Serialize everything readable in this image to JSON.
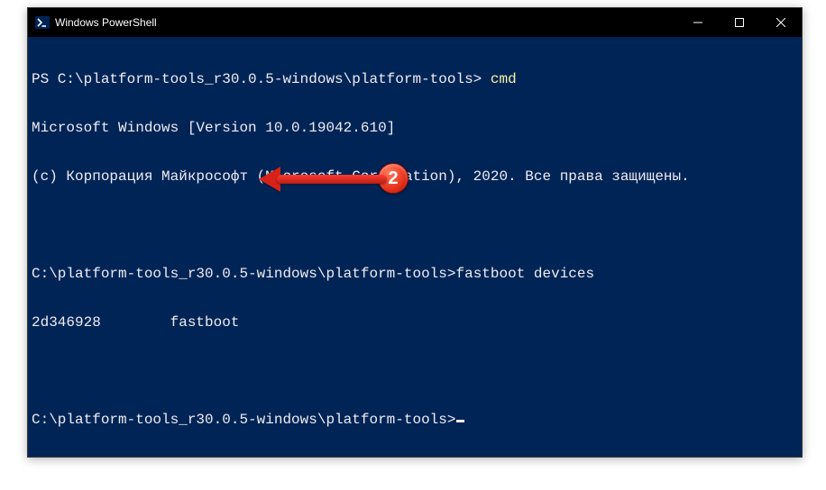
{
  "titlebar": {
    "title": "Windows PowerShell"
  },
  "terminal": {
    "l1_prompt": "PS C:\\platform-tools_r30.0.5-windows\\platform-tools> ",
    "l1_cmd": "cmd",
    "l2": "Microsoft Windows [Version 10.0.19042.610]",
    "l3": "(c) Корпорация Майкрософт (Microsoft Corporation), 2020. Все права защищены.",
    "l5_prompt": "C:\\platform-tools_r30.0.5-windows\\platform-tools>",
    "l5_cmd": "fastboot devices",
    "l6": "2d346928        fastboot",
    "l8_prompt": "C:\\platform-tools_r30.0.5-windows\\platform-tools>"
  },
  "annotation": {
    "badge_number": "2"
  }
}
